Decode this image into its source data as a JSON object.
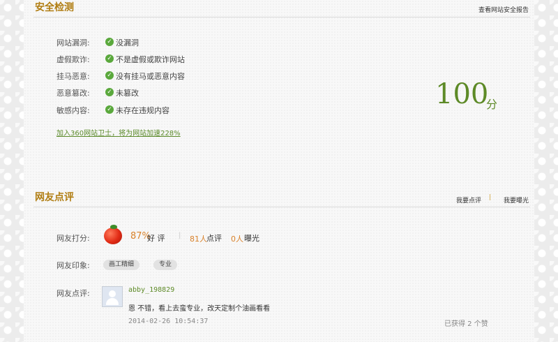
{
  "security": {
    "title": "安全检测",
    "report_link": "查看网站安全报告",
    "items": [
      {
        "label": "网站漏洞:",
        "value": "没漏洞"
      },
      {
        "label": "虚假欺诈:",
        "value": "不是虚假或欺诈网站"
      },
      {
        "label": "挂马恶意:",
        "value": "没有挂马或恶意内容"
      },
      {
        "label": "恶意篡改:",
        "value": "未篡改"
      },
      {
        "label": "敏感内容:",
        "value": "未存在违规内容"
      }
    ],
    "promo_link": "加入360网站卫士，将为网站加速228%",
    "score": "100",
    "score_unit": "分"
  },
  "reviews": {
    "title": "网友点评",
    "actions": [
      "我要点评",
      "我要曝光"
    ],
    "rating_label": "网友打分:",
    "rating_percent": "87%",
    "rating_text": "好 评",
    "review_count": "81人",
    "review_count_text": "点评",
    "exposure_count": "0人",
    "exposure_text": "曝光",
    "impression_label": "网友印象:",
    "tags": [
      "画工精细",
      "专业"
    ],
    "comment_label": "网友点评:",
    "comment": {
      "user": "abby_198829",
      "text": "恩 不错，看上去蛮专业，改天定制个油画看看",
      "time": "2014-02-26 10:54:37",
      "likes": "已获得 2 个赞"
    }
  },
  "colors": {
    "accent": "#b07d12",
    "green": "#5d8a27",
    "check": "#5aa83c",
    "orange": "#d9822b"
  }
}
